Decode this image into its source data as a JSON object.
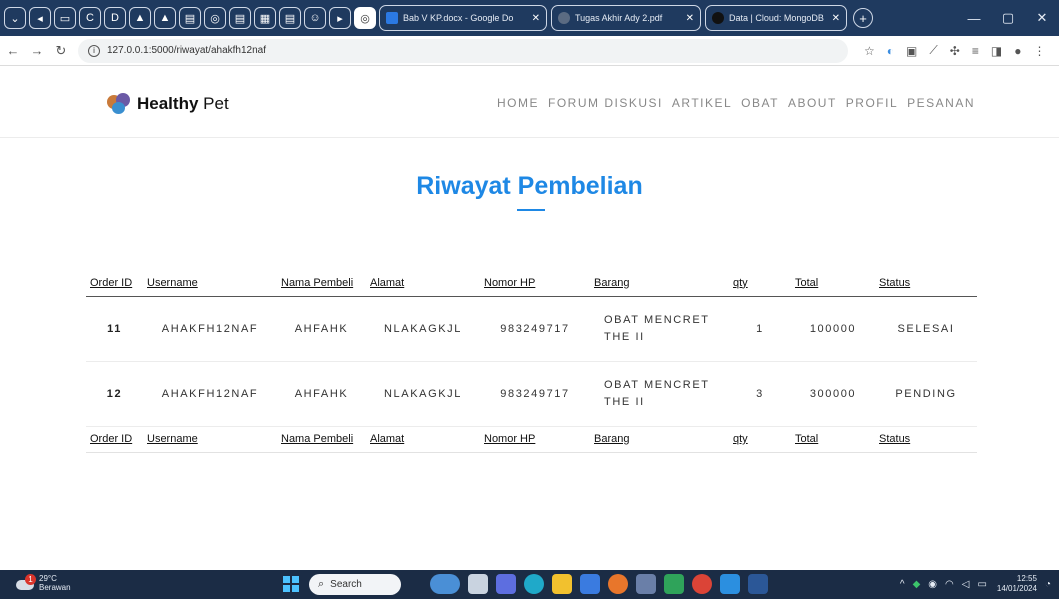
{
  "browser": {
    "tabs": [
      {
        "label": "Bab V KP.docx - Google Do",
        "color": "#2b79e3"
      },
      {
        "label": "Tugas Akhir Ady 2.pdf",
        "color": "#5b6b82"
      },
      {
        "label": "Data | Cloud: MongoDB Cl",
        "color": "#111111"
      }
    ],
    "url": "127.0.0.1:5000/riwayat/ahakfh12naf"
  },
  "site": {
    "logo_bold": "Healthy",
    "logo_rest": " Pet",
    "nav": [
      "HOME",
      "FORUM DISKUSI",
      "ARTIKEL",
      "OBAT",
      "ABOUT",
      "PROFIL",
      "PESANAN"
    ]
  },
  "page": {
    "title": "Riwayat Pembelian"
  },
  "table": {
    "headers": [
      "Order ID",
      "Username",
      "Nama Pembeli",
      "Alamat",
      "Nomor HP",
      "Barang",
      "qty",
      "Total",
      "Status"
    ],
    "rows": [
      {
        "order_id": "11",
        "username": "AHAKFH12NAF",
        "nama": "AHFAHK",
        "alamat": "NLAKAGKJL",
        "hp": "983249717",
        "barang_1": "OBAT MENCRET",
        "barang_2": "THE II",
        "qty": "1",
        "total": "100000",
        "status": "SELESAI"
      },
      {
        "order_id": "12",
        "username": "AHAKFH12NAF",
        "nama": "AHFAHK",
        "alamat": "NLAKAGKJL",
        "hp": "983249717",
        "barang_1": "OBAT MENCRET",
        "barang_2": "THE II",
        "qty": "3",
        "total": "300000",
        "status": "PENDING"
      }
    ]
  },
  "taskbar": {
    "weather_temp": "29°C",
    "weather_desc": "Berawan",
    "weather_badge": "1",
    "search_placeholder": "Search",
    "time": "12:55",
    "date": "14/01/2024"
  }
}
